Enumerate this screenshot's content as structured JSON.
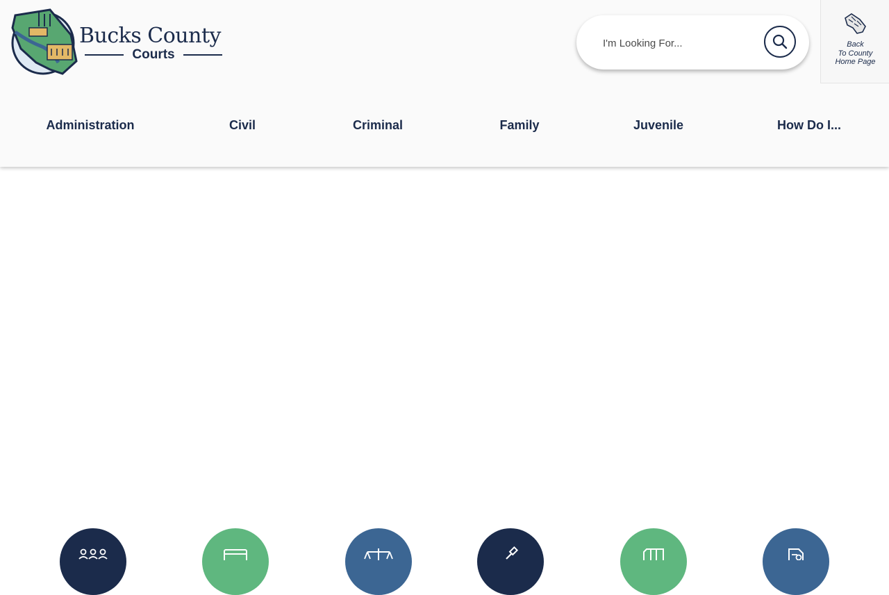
{
  "header": {
    "logo": {
      "title": "Bucks County",
      "subtitle": "Courts"
    },
    "search": {
      "placeholder": "I'm Looking For..."
    },
    "back_link": {
      "line1": "Back",
      "line2": "To County",
      "line3": "Home Page"
    }
  },
  "nav": {
    "items": [
      {
        "label": "Administration"
      },
      {
        "label": "Civil"
      },
      {
        "label": "Criminal"
      },
      {
        "label": "Family"
      },
      {
        "label": "Juvenile"
      },
      {
        "label": "How Do I..."
      }
    ]
  },
  "quick_links": [
    {
      "icon": "people-icon",
      "color": "#1b2b4b"
    },
    {
      "icon": "card-icon",
      "color": "#5fb77f"
    },
    {
      "icon": "scales-icon",
      "color": "#3c6693"
    },
    {
      "icon": "gavel-icon",
      "color": "#1b2b4b"
    },
    {
      "icon": "building-icon",
      "color": "#5fb77f"
    },
    {
      "icon": "document-icon",
      "color": "#3c6693"
    }
  ],
  "colors": {
    "navy": "#1b2b4b",
    "green": "#5fb77f",
    "blue": "#3c6693",
    "header_bg": "#fafafa"
  }
}
